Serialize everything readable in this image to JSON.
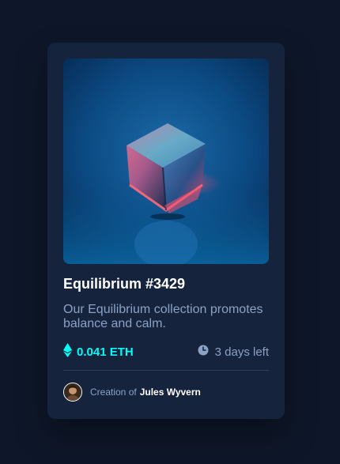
{
  "card": {
    "image_alt": "Equilibrium",
    "title": "Equilibrium #3429",
    "description": "Our Equilibrium collection promotes balance and calm.",
    "price": "0.041 ETH",
    "time_left": "3 days left",
    "creator_prefix": "Creation of",
    "creator_name": "Jules Wyvern"
  },
  "icons": {
    "price": "ethereum-icon",
    "time": "clock-icon"
  },
  "colors": {
    "page_background": "#0e1729",
    "card_background": "#15233d",
    "accent_cyan": "#00fff8",
    "soft_blue_text": "#8ba2c4",
    "divider": "#2e405a",
    "white": "#ffffff"
  }
}
